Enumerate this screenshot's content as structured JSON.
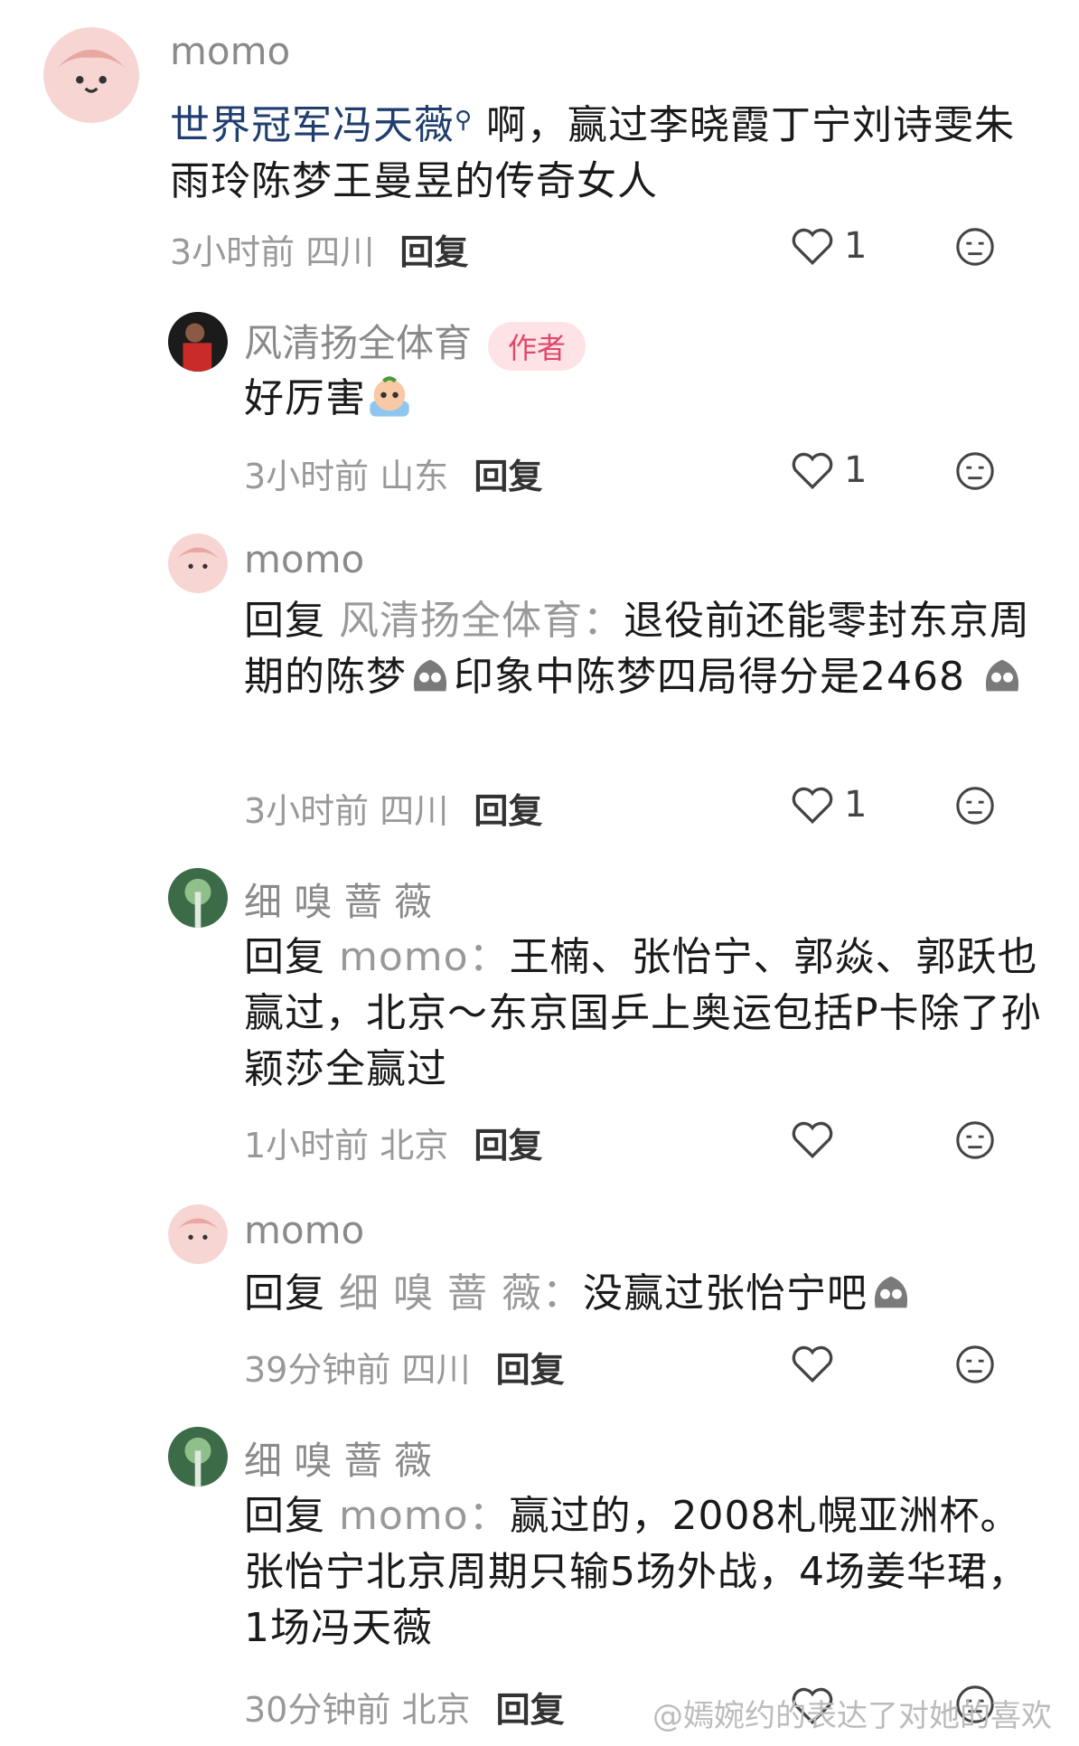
{
  "comments": [
    {
      "username": "momo",
      "link_text": "世界冠军冯天薇",
      "text": "啊，赢过李晓霞丁宁刘诗雯朱雨玲陈梦王曼昱的传奇女人",
      "time": "3小时前",
      "location": "四川",
      "reply": "回复",
      "likes": "1"
    },
    {
      "username": "风清扬全体育",
      "badge": "作者",
      "text": "好厉害",
      "time": "3小时前",
      "location": "山东",
      "reply": "回复",
      "likes": "1"
    },
    {
      "username": "momo",
      "reply_prefix": "回复",
      "reply_to": "风清扬全体育：",
      "text_a": "退役前还能零封东京周期的陈梦",
      "text_b": "印象中陈梦四局得分是2468",
      "time": "3小时前",
      "location": "四川",
      "reply": "回复",
      "likes": "1"
    },
    {
      "username": "细 嗅 蔷 薇",
      "reply_prefix": "回复",
      "reply_to": "momo：",
      "text": "王楠、张怡宁、郭焱、郭跃也赢过，北京～东京国乒上奥运包括P卡除了孙颖莎全赢过",
      "time": "1小时前",
      "location": "北京",
      "reply": "回复"
    },
    {
      "username": "momo",
      "reply_prefix": "回复",
      "reply_to": "细 嗅 蔷 薇：",
      "text": "没赢过张怡宁吧",
      "time": "39分钟前",
      "location": "四川",
      "reply": "回复"
    },
    {
      "username": "细 嗅 蔷 薇",
      "reply_prefix": "回复",
      "reply_to": "momo：",
      "text_a": "赢过的，2008札幌亚洲杯。",
      "text_b": "张怡宁北京周期只输5场外战，4场姜华珺，",
      "text_c": "1场冯天薇",
      "time": "30分钟前",
      "location": "北京",
      "reply": "回复"
    }
  ],
  "watermark": "@嫣婉约的表达了对她的喜欢"
}
